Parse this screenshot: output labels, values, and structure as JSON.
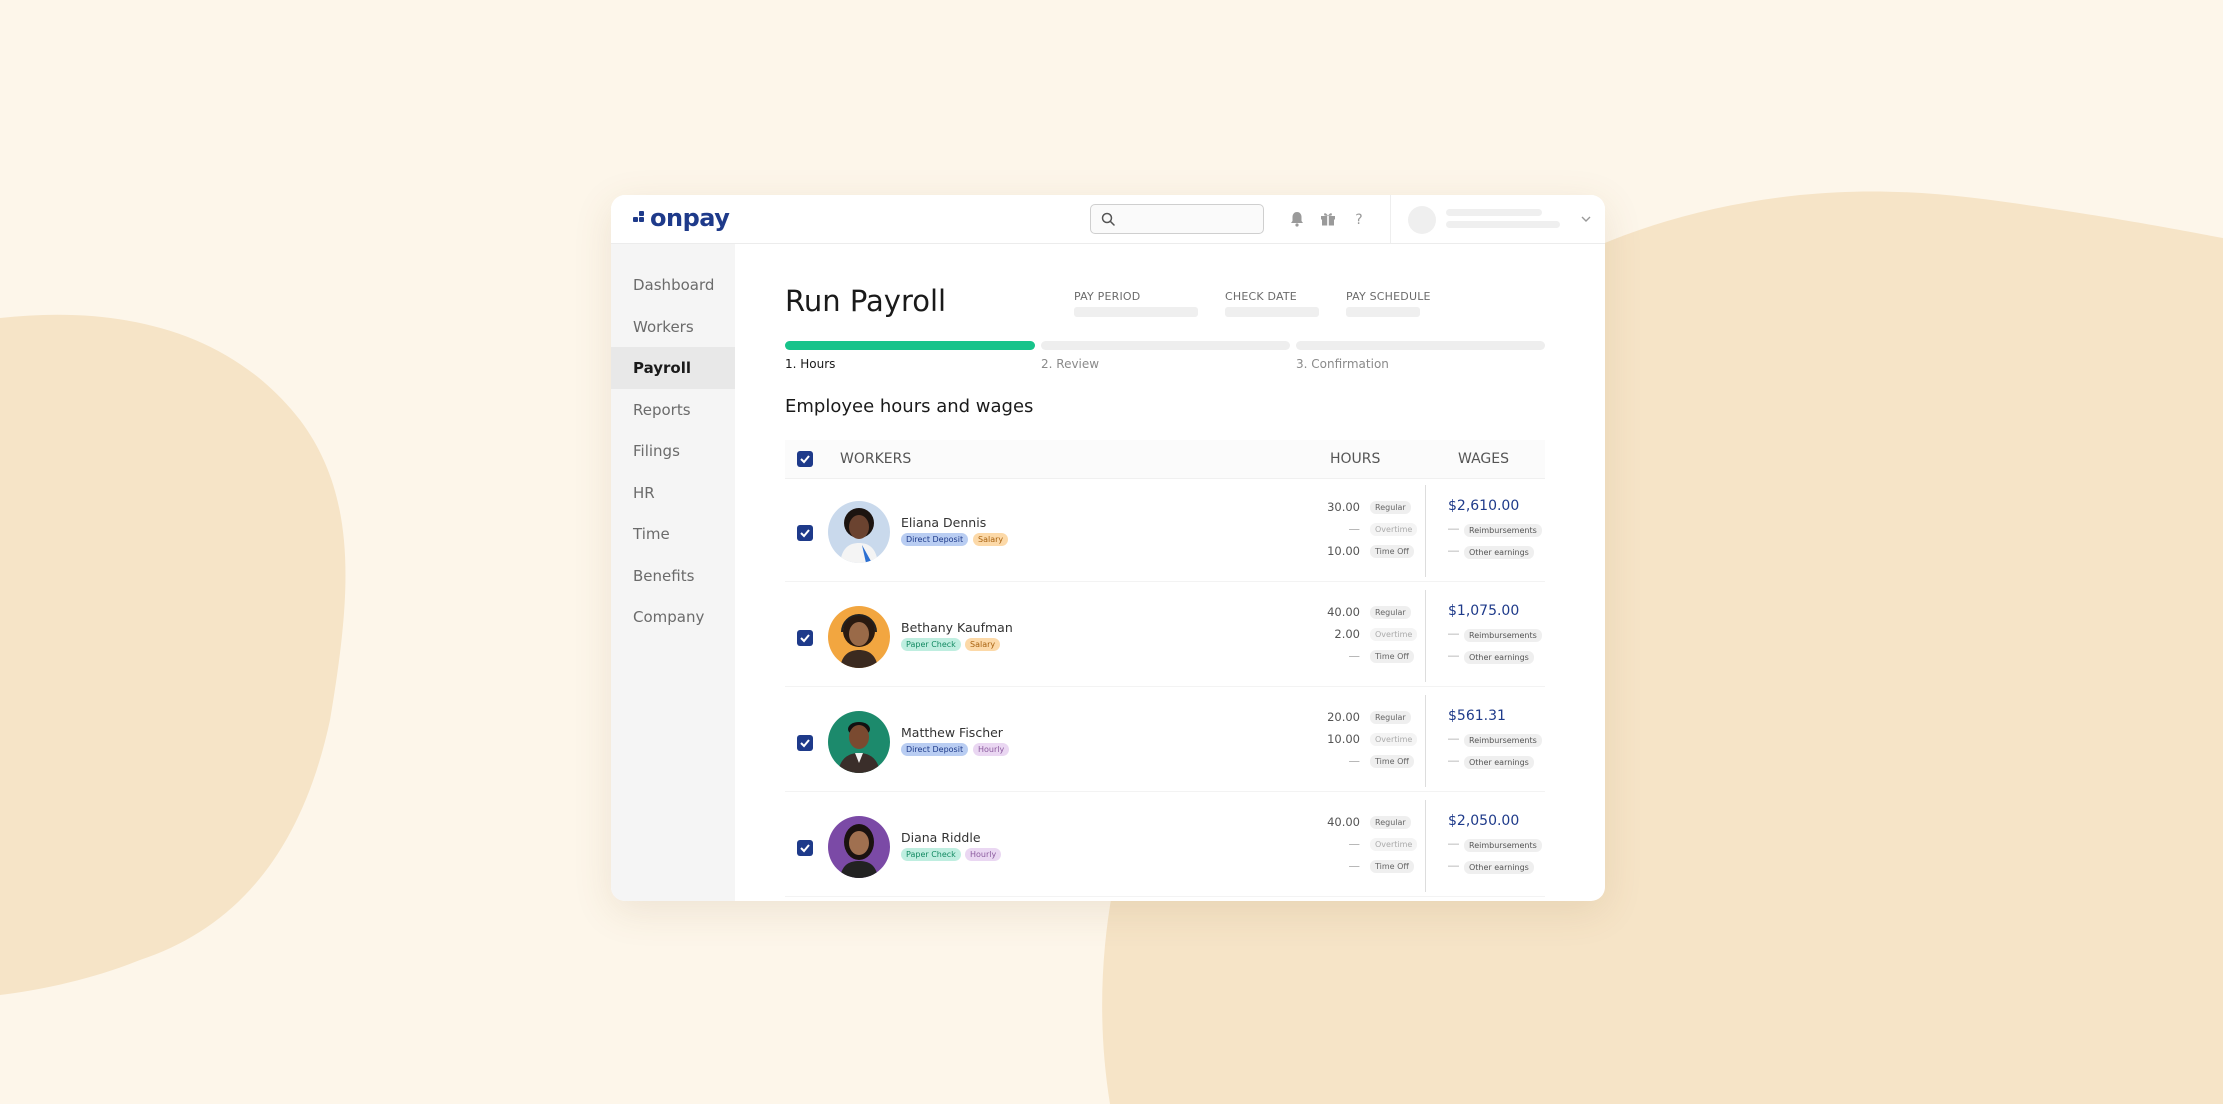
{
  "brand": {
    "logo_text": "onpay",
    "color": "#1e3a8a",
    "accent": "#17c38a"
  },
  "topbar": {
    "search_placeholder": "",
    "icons": [
      "search-icon",
      "bell-icon",
      "gift-icon",
      "help-icon",
      "chevron-down-icon"
    ]
  },
  "sidebar": {
    "items": [
      {
        "label": "Dashboard",
        "active": false
      },
      {
        "label": "Workers",
        "active": false
      },
      {
        "label": "Payroll",
        "active": true
      },
      {
        "label": "Reports",
        "active": false
      },
      {
        "label": "Filings",
        "active": false
      },
      {
        "label": "HR",
        "active": false
      },
      {
        "label": "Time",
        "active": false
      },
      {
        "label": "Benefits",
        "active": false
      },
      {
        "label": "Company",
        "active": false
      }
    ]
  },
  "page": {
    "title": "Run Payroll",
    "meta": {
      "pay_period": "PAY PERIOD",
      "check_date": "CHECK DATE",
      "pay_schedule": "PAY SCHEDULE"
    },
    "steps": [
      {
        "label": "1. Hours",
        "progress": 1.0
      },
      {
        "label": "2. Review",
        "progress": 0
      },
      {
        "label": "3. Confirmation",
        "progress": 0
      }
    ],
    "section_title": "Employee hours and wages"
  },
  "table": {
    "headers": {
      "workers": "WORKERS",
      "hours": "HOURS",
      "wages": "WAGES"
    },
    "header_checked": true,
    "hour_labels": {
      "regular": "Regular",
      "overtime": "Overtime",
      "time_off": "Time Off"
    },
    "earning_labels": {
      "reimbursements": "Reimbursements",
      "other": "Other earnings"
    },
    "dash": "—",
    "rows": [
      {
        "name": "Eliana Dennis",
        "payment": "Direct Deposit",
        "type": "Salary",
        "regular": "30.00",
        "overtime": "—",
        "time_off": "10.00",
        "wage": "$2,610.00",
        "checked": true
      },
      {
        "name": "Bethany Kaufman",
        "payment": "Paper Check",
        "type": "Salary",
        "regular": "40.00",
        "overtime": "2.00",
        "time_off": "—",
        "wage": "$1,075.00",
        "checked": true
      },
      {
        "name": "Matthew Fischer",
        "payment": "Direct Deposit",
        "type": "Hourly",
        "regular": "20.00",
        "overtime": "10.00",
        "time_off": "—",
        "wage": "$561.31",
        "checked": true
      },
      {
        "name": "Diana Riddle",
        "payment": "Paper Check",
        "type": "Hourly",
        "regular": "40.00",
        "overtime": "—",
        "time_off": "—",
        "wage": "$2,050.00",
        "checked": true
      }
    ]
  }
}
